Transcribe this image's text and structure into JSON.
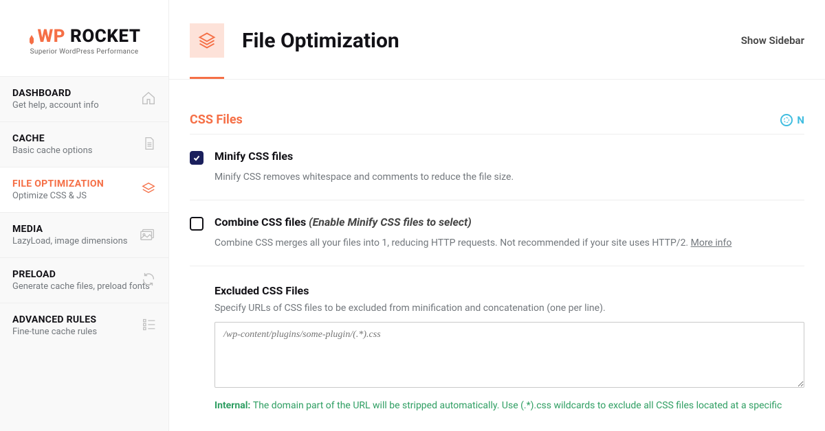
{
  "brand": {
    "name_prefix": "WP",
    "name_rest": " ROCKET",
    "tagline": "Superior WordPress Performance"
  },
  "sidebar": {
    "items": [
      {
        "title": "DASHBOARD",
        "sub": "Get help, account info"
      },
      {
        "title": "CACHE",
        "sub": "Basic cache options"
      },
      {
        "title": "FILE OPTIMIZATION",
        "sub": "Optimize CSS & JS"
      },
      {
        "title": "MEDIA",
        "sub": "LazyLoad, image dimensions"
      },
      {
        "title": "PRELOAD",
        "sub": "Generate cache files, preload fonts"
      },
      {
        "title": "ADVANCED RULES",
        "sub": "Fine-tune cache rules"
      }
    ]
  },
  "header": {
    "title": "File Optimization",
    "show_sidebar": "Show Sidebar"
  },
  "section": {
    "title": "CSS Files",
    "help_letter": "N"
  },
  "settings": {
    "minify": {
      "title": "Minify CSS files",
      "desc": "Minify CSS removes whitespace and comments to reduce the file size."
    },
    "combine": {
      "title": "Combine CSS files ",
      "hint": "(Enable Minify CSS files to select)",
      "desc": "Combine CSS merges all your files into 1, reducing HTTP requests. Not recommended if your site uses HTTP/2. ",
      "more": "More info"
    },
    "excluded": {
      "title": "Excluded CSS Files",
      "desc": "Specify URLs of CSS files to be excluded from minification and concatenation (one per line).",
      "placeholder": "/wp-content/plugins/some-plugin/(.*).css"
    },
    "internal": {
      "label": "Internal: ",
      "text": "The domain part of the URL will be stripped automatically. Use (.*).css wildcards to exclude all CSS files located at a specific"
    }
  }
}
